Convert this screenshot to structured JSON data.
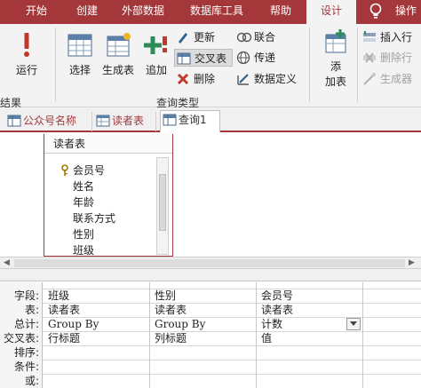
{
  "ribbon_tabs": [
    {
      "label": "开始"
    },
    {
      "label": "创建"
    },
    {
      "label": "外部数据"
    },
    {
      "label": "数据库工具"
    },
    {
      "label": "帮助"
    },
    {
      "label": "设计",
      "active": true
    },
    {
      "label": "操作"
    }
  ],
  "ribbon": {
    "run_label": "运行",
    "select_label": "选择",
    "maketable_label": "生成表",
    "append_label": "追加",
    "update_label": "更新",
    "crosstab_label": "交叉表",
    "delete_label": "删除",
    "union_label": "联合",
    "passthrough_label": "传递",
    "datadef_label": "数据定义",
    "addtable_label_1": "添",
    "addtable_label_2": "加表",
    "insertrow_label": "插入行",
    "deleterow_label": "删除行",
    "builder_label": "生成器",
    "group_results_label": "结果",
    "group_querytype_label": "查询类型"
  },
  "doc_tabs": [
    {
      "label": "公众号名称"
    },
    {
      "label": "读者表"
    },
    {
      "label": "查询1",
      "active": true
    }
  ],
  "table_box": {
    "title": "读者表",
    "fields": [
      "会员号",
      "姓名",
      "年龄",
      "联系方式",
      "性别",
      "班级"
    ]
  },
  "grid": {
    "row_labels": [
      "字段:",
      "表:",
      "总计:",
      "交叉表:",
      "排序:",
      "条件:",
      "或:"
    ],
    "columns": [
      {
        "field": "班级",
        "table": "读者表",
        "total": "Group By",
        "crosstab": "行标题"
      },
      {
        "field": "性别",
        "table": "读者表",
        "total": "Group By",
        "crosstab": "列标题"
      },
      {
        "field": "会员号",
        "table": "读者表",
        "total": "计数",
        "crosstab": "值"
      }
    ]
  },
  "colors": {
    "accent": "#a4373a",
    "ribbon_bg": "#f3f3f3"
  }
}
